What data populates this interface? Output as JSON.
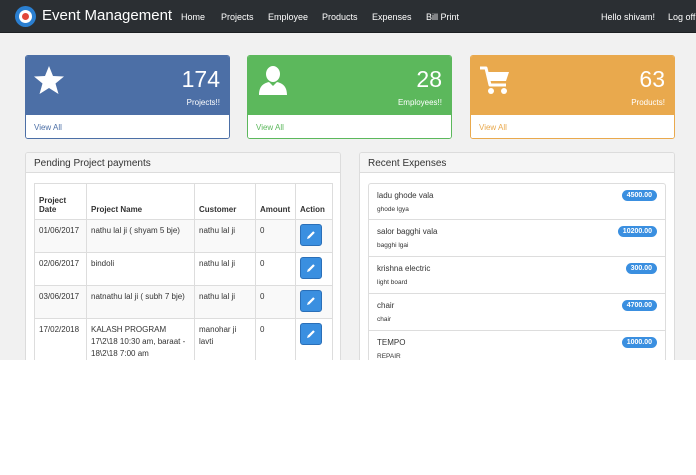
{
  "brand": {
    "name": "Event Management",
    "logo_icon": "target-logo-icon"
  },
  "nav": {
    "links": [
      "Home",
      "Projects",
      "Employee",
      "Products",
      "Expenses",
      "Bill Print"
    ],
    "greeting": "Hello shivam!",
    "logoff": "Log off"
  },
  "stats": [
    {
      "number": "174",
      "label": "Projects!!",
      "link": "View All",
      "icon": "star-icon",
      "color": "#4c6fa6"
    },
    {
      "number": "28",
      "label": "Employees!!",
      "link": "View All",
      "icon": "user-icon",
      "color": "#5cb85c"
    },
    {
      "number": "63",
      "label": "Products!",
      "link": "View All",
      "icon": "cart-icon",
      "color": "#e9a94d"
    }
  ],
  "payments": {
    "title": "Pending Project payments",
    "headers": [
      "Project Date",
      "Project Name",
      "Customer",
      "Amount",
      "Action"
    ],
    "rows": [
      {
        "date": "01/06/2017",
        "name": "nathu lal ji ( shyam 5 bje)",
        "customer": "nathu lal ji",
        "amount": "0"
      },
      {
        "date": "02/06/2017",
        "name": "bindoli",
        "customer": "nathu lal ji",
        "amount": "0"
      },
      {
        "date": "03/06/2017",
        "name": "natnathu lal ji ( subh 7 bje)",
        "customer": "nathu lal ji",
        "amount": "0"
      },
      {
        "date": "17/02/2018",
        "name": "KALASH PROGRAM 17\\2\\18 10:30 am, baraat - 18\\2\\18 7:00 am",
        "customer": "manohar ji lavti",
        "amount": "0"
      }
    ]
  },
  "expenses": {
    "title": "Recent Expenses",
    "items": [
      {
        "name": "ladu ghode vala",
        "desc": "ghode lgya",
        "amount": "4500.00"
      },
      {
        "name": "salor bagghi vala",
        "desc": "bagghi lgai",
        "amount": "10200.00"
      },
      {
        "name": "krishna electric",
        "desc": "light board",
        "amount": "300.00"
      },
      {
        "name": "chair",
        "desc": "chair",
        "amount": "4700.00"
      },
      {
        "name": "TEMPO",
        "desc": "REPAIR",
        "amount": "1000.00"
      }
    ]
  },
  "colors": {
    "navbar": "#2b2f33",
    "primary": "#4c6fa6",
    "success": "#5cb85c",
    "warning": "#e9a94d",
    "button": "#3a8fe0"
  }
}
